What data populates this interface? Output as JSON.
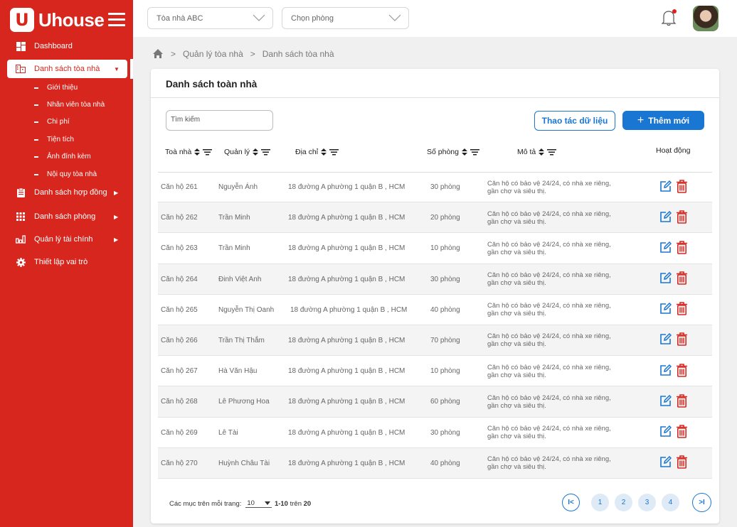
{
  "brand": {
    "name": "Uhouse",
    "mark": "U"
  },
  "sidebar": {
    "items": [
      {
        "label": "Dashboard",
        "icon": "dashboard-icon"
      },
      {
        "label": "Danh sách tòa nhà",
        "icon": "building-icon"
      },
      {
        "label": "Danh sách hợp đồng",
        "icon": "contract-icon"
      },
      {
        "label": "Danh sách phòng",
        "icon": "grid-icon"
      },
      {
        "label": "Quản lý tài chính",
        "icon": "finance-icon"
      },
      {
        "label": "Thiết lập vai trò",
        "icon": "gear-icon"
      }
    ],
    "subitems": [
      "Giới thiệu",
      "Nhân viên tòa nhà",
      "Chi phí",
      "Tiện tích",
      "Ảnh đính kèm",
      "Nội quy tòa nhà"
    ]
  },
  "topbar": {
    "building_select": "Tòa nhà ABC",
    "room_select": "Chọn phòng"
  },
  "breadcrumb": {
    "level1": "Quản lý tòa nhà",
    "level2": "Danh sách tòa nhà",
    "separator": ">"
  },
  "card": {
    "title": "Danh sách toàn nhà",
    "search_placeholder": "Tìm kiếm",
    "data_ops_label": "Thao tác dữ liệu",
    "add_label": "Thêm mới"
  },
  "table": {
    "headers": {
      "name": "Toà nhà",
      "manager": "Quản lý",
      "address": "Địa chỉ",
      "rooms": "Số phòng",
      "desc": "Mô tả",
      "action": "Hoạt động"
    },
    "rows": [
      {
        "name": "Căn hộ 261",
        "manager": "Nguyễn Ánh",
        "address": "18 đường A phường 1 quận B , HCM",
        "rooms": "30 phòng",
        "desc1": "Căn hộ có bảo vệ 24/24, có nhà xe riêng,",
        "desc2": "gần chợ và siêu thị."
      },
      {
        "name": "Căn hộ 262",
        "manager": "Trần Minh",
        "address": "18 đường A phường 1 quận B , HCM",
        "rooms": "20 phòng",
        "desc1": "Căn hộ có bảo vệ 24/24, có nhà xe riêng,",
        "desc2": "gần chợ và siêu thị."
      },
      {
        "name": "Căn hộ 263",
        "manager": "Trần Minh",
        "address": "18 đường A phường 1 quận B , HCM",
        "rooms": "10 phòng",
        "desc1": "Căn hộ có bảo vệ 24/24, có nhà xe riêng,",
        "desc2": "gần chợ và siêu thị."
      },
      {
        "name": "Căn hộ 264",
        "manager": "Đinh Việt Anh",
        "address": "18 đường A phường 1 quận B , HCM",
        "rooms": "30 phòng",
        "desc1": "Căn hộ có bảo vệ 24/24, có nhà xe riêng,",
        "desc2": "gần chợ và siêu thị."
      },
      {
        "name": "Căn hộ 265",
        "manager": "Nguyễn Thị Oanh",
        "address": "18 đường A phường 1 quận B , HCM",
        "rooms": "40 phòng",
        "desc1": "Căn hộ có bảo vệ 24/24, có nhà xe riêng,",
        "desc2": "gần chợ và siêu thị."
      },
      {
        "name": "Căn hộ 266",
        "manager": "Trần Thị Thắm",
        "address": "18 đường A phường 1 quận B , HCM",
        "rooms": "70 phòng",
        "desc1": "Căn hộ có bảo vệ 24/24, có nhà xe riêng,",
        "desc2": "gần chợ và siêu thị."
      },
      {
        "name": "Căn hộ 267",
        "manager": "Hà Văn Hậu",
        "address": "18 đường A phường 1 quận B , HCM",
        "rooms": "10 phòng",
        "desc1": "Căn hộ có bảo vệ 24/24, có nhà xe riêng,",
        "desc2": "gần chợ và siêu thị."
      },
      {
        "name": "Căn hộ 268",
        "manager": "Lê Phương Hoa",
        "address": "18 đường A phường 1 quận B , HCM",
        "rooms": "60 phòng",
        "desc1": "Căn hộ có bảo vệ 24/24, có nhà xe riêng,",
        "desc2": "gần chợ và siêu thị."
      },
      {
        "name": "Căn hộ 269",
        "manager": "Lê Tài",
        "address": "18 đường A phường 1 quận B , HCM",
        "rooms": "30 phòng",
        "desc1": "Căn hộ có bảo vệ 24/24, có nhà xe riêng,",
        "desc2": "gần chợ và siêu thị."
      },
      {
        "name": "Căn hộ 270",
        "manager": "Huỳnh Châu Tài",
        "address": "18 đường A phường 1 quận B , HCM",
        "rooms": "40 phòng",
        "desc1": "Căn hộ có bảo vệ 24/24, có nhà xe riêng,",
        "desc2": "gần chợ và siêu thị."
      }
    ]
  },
  "pagination": {
    "per_page_label": "Các mục trên mỗi trang:",
    "per_page_value": "10",
    "range": "1-10",
    "of_label": "trên",
    "total": "20",
    "first_label": "I<",
    "last_label": ">I",
    "pages": [
      "1",
      "2",
      "3",
      "4"
    ]
  },
  "colors": {
    "brand": "#d7261e",
    "primary": "#1976d2",
    "danger": "#d7261e"
  }
}
